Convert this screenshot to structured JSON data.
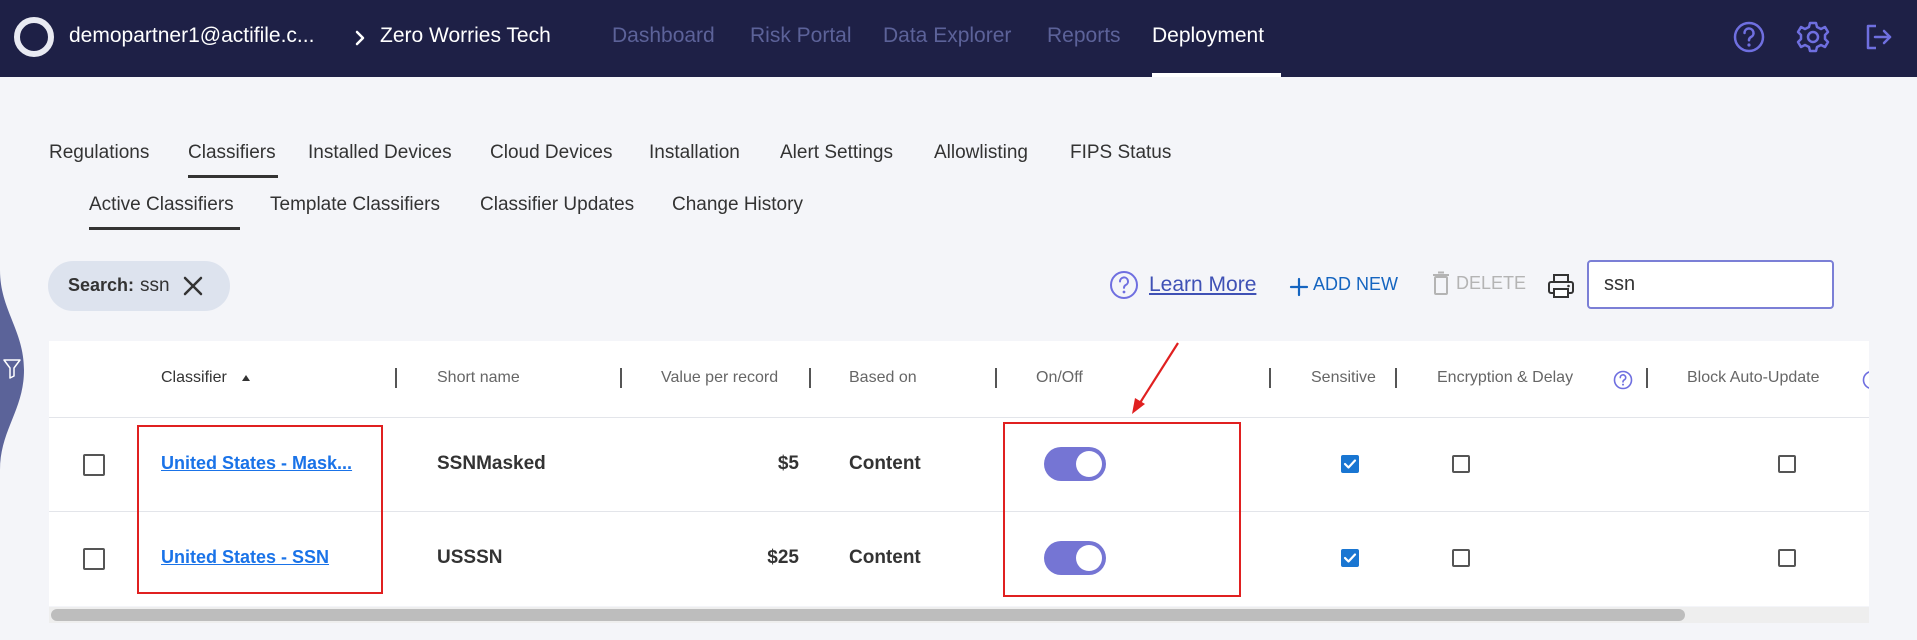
{
  "header": {
    "account": "demopartner1@actifile.c...",
    "tenant": "Zero Worries Tech",
    "nav": [
      "Dashboard",
      "Risk Portal",
      "Data Explorer",
      "Reports",
      "Deployment"
    ],
    "active_nav": "Deployment",
    "icons": [
      "help-icon",
      "settings-icon",
      "logout-icon"
    ]
  },
  "tabs": {
    "primary": [
      "Regulations",
      "Classifiers",
      "Installed Devices",
      "Cloud Devices",
      "Installation",
      "Alert Settings",
      "Allowlisting",
      "FIPS Status"
    ],
    "primary_active": "Classifiers",
    "secondary": [
      "Active Classifiers",
      "Template Classifiers",
      "Classifier Updates",
      "Change History"
    ],
    "secondary_active": "Active Classifiers"
  },
  "toolbar": {
    "chip_label": "Search:",
    "chip_value": "ssn",
    "learn_more": "Learn More",
    "add_new": "ADD NEW",
    "delete": "DELETE",
    "search_value": "ssn"
  },
  "table": {
    "columns": [
      "Classifier",
      "Short name",
      "Value per record",
      "Based on",
      "On/Off",
      "Sensitive",
      "Encryption & Delay",
      "Block Auto-Update"
    ],
    "sorted_column": "Classifier",
    "rows": [
      {
        "classifier": "United States - Mask...",
        "short_name": "SSNMasked",
        "value": "$5",
        "based_on": "Content",
        "on": true,
        "sensitive": true,
        "encryption": false,
        "block_auto_update": false,
        "selected": false
      },
      {
        "classifier": "United States - SSN",
        "short_name": "USSSN",
        "value": "$25",
        "based_on": "Content",
        "on": true,
        "sensitive": true,
        "encryption": false,
        "block_auto_update": false,
        "selected": false
      }
    ]
  },
  "scrollbar": {
    "thumb_fraction": 0.9
  },
  "colors": {
    "topbar": "#1e2046",
    "toggle_on": "#7575d4",
    "link": "#1a73e8",
    "annotation": "#e02020"
  }
}
